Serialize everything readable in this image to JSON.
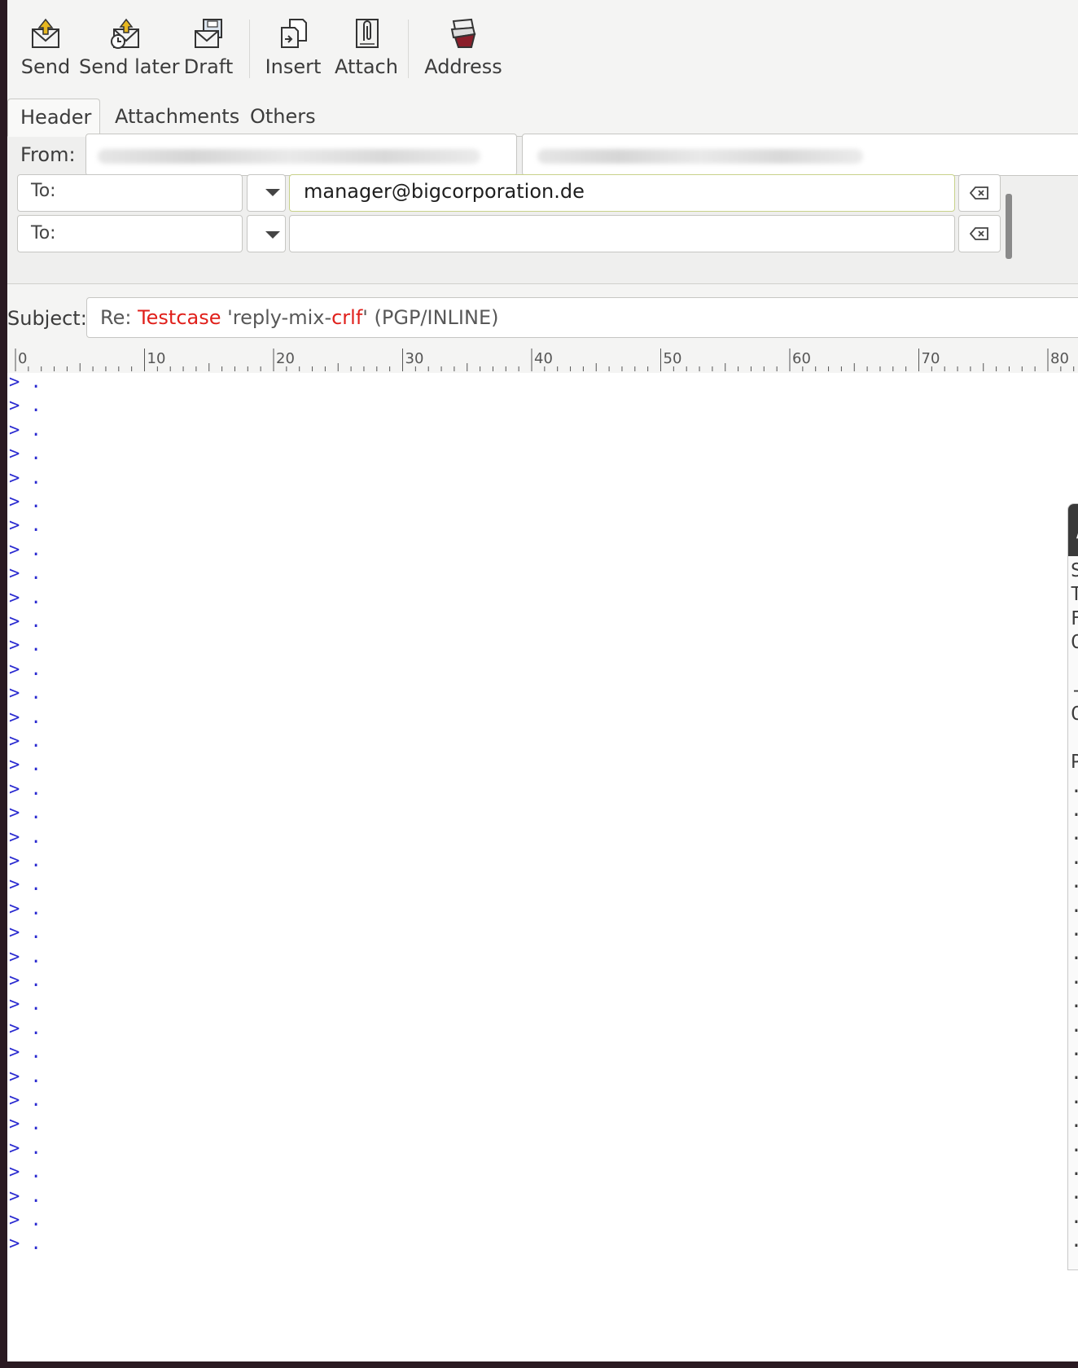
{
  "toolbar": {
    "send_label": "Send",
    "send_later_label": "Send later",
    "draft_label": "Draft",
    "insert_label": "Insert",
    "attach_label": "Attach",
    "address_label": "Address",
    "icons": [
      "envelope-send-icon",
      "envelope-clock-icon",
      "floppy-draft-icon",
      "insert-file-icon",
      "paperclip-attach-icon",
      "address-book-icon"
    ]
  },
  "tabs": {
    "header": "Header",
    "attachments": "Attachments",
    "others": "Others"
  },
  "header": {
    "from_label": "From:",
    "recipients": [
      {
        "type": "To:",
        "value": "manager@bigcorporation.de"
      },
      {
        "type": "To:",
        "value": ""
      }
    ]
  },
  "subject": {
    "label": "Subject:",
    "prefix": "Re: ",
    "word1": "Testcase",
    "mid": " 'reply-mix-",
    "word2": "crlf",
    "suffix": "' (PGP/INLINE)"
  },
  "ruler": {
    "marks": [
      "0",
      "10",
      "20",
      "30",
      "40",
      "50",
      "60",
      "70",
      "80"
    ]
  },
  "body": {
    "quoted_lines": [
      "> .",
      "> .",
      "> .",
      "> .",
      "> .",
      "> .",
      "> .",
      "> .",
      "> .",
      "> .",
      "> .",
      "> .",
      "> .",
      "> .",
      "> .",
      "> .",
      "> .",
      "> .",
      "> .",
      "> .",
      "> .",
      "> .",
      "> .",
      "> .",
      "> .",
      "> .",
      "> .",
      "> .",
      "> .",
      "> .",
      "> .",
      "> .",
      "> .",
      "> .",
      "> .",
      "> .",
      "> ."
    ]
  },
  "popup": {
    "title": "/",
    "lines": [
      "Su",
      "To",
      "Fr",
      "Cc",
      "",
      "-",
      "Co",
      "",
      "Pl",
      ". ",
      ". ",
      ". ",
      ". ",
      ". ",
      ". ",
      ". ",
      ". ",
      ". ",
      ". ",
      ". ",
      ". ",
      ". ",
      ". ",
      ". ",
      ". ",
      ". ",
      ". ",
      ". ",
      ". "
    ]
  },
  "colors": {
    "quote": "#2a2ad0",
    "misspelled": "#e0201b",
    "accent_border": "#c8d28a"
  }
}
